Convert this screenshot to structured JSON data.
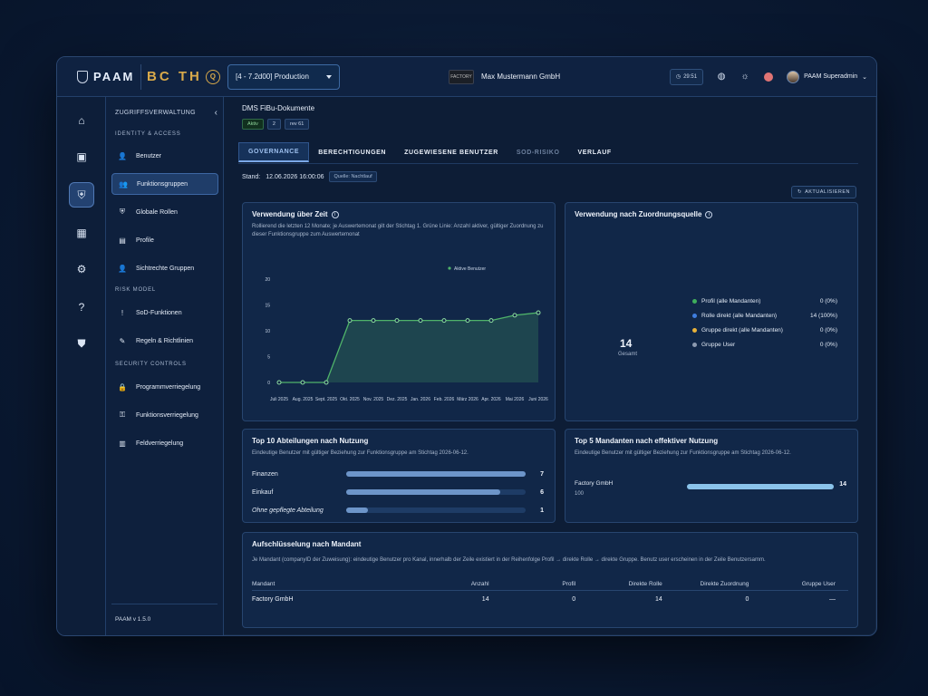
{
  "topbar": {
    "brand": "PAAM",
    "partner_logo": "BC TH",
    "partner_logo_q": "Q",
    "env_select": "[4 - 7.2d00] Production",
    "company_logo_text": "FACTORY",
    "company_name": "Max Mustermann GmbH",
    "timer": "29:51",
    "user_name": "PAAM Superadmin"
  },
  "rail": {
    "items": [
      {
        "icon": "home-icon",
        "glyph": "⌂"
      },
      {
        "icon": "monitor-icon",
        "glyph": "▣"
      },
      {
        "icon": "shield-user-icon",
        "glyph": "⛨"
      },
      {
        "icon": "building-icon",
        "glyph": "▦"
      },
      {
        "icon": "cogs-icon",
        "glyph": "⚙"
      },
      {
        "icon": "help-icon",
        "glyph": "?"
      },
      {
        "icon": "shield-check-icon",
        "glyph": "⛊"
      }
    ]
  },
  "sidebar": {
    "title": "ZUGRIFFSVERWALTUNG",
    "sections": {
      "identity": "IDENTITY & ACCESS",
      "risk": "RISK MODEL",
      "security": "SECURITY CONTROLS"
    },
    "items": [
      {
        "label": "Benutzer",
        "glyph": "👤"
      },
      {
        "label": "Funktionsgruppen",
        "glyph": "👥"
      },
      {
        "label": "Globale Rollen",
        "glyph": "⛨"
      },
      {
        "label": "Profile",
        "glyph": "▤"
      },
      {
        "label": "Sichtrechte Gruppen",
        "glyph": "👤"
      },
      {
        "label": "SoD-Funktionen",
        "glyph": "!"
      },
      {
        "label": "Regeln & Richtlinien",
        "glyph": "✎"
      },
      {
        "label": "Programmverriegelung",
        "glyph": "🔒"
      },
      {
        "label": "Funktionsverriegelung",
        "glyph": "⚿"
      },
      {
        "label": "Feldverriegelung",
        "glyph": "▥"
      }
    ],
    "version": "PAAM v 1.5.0"
  },
  "main": {
    "doc_title": "DMS FiBu-Dokumente",
    "badges": [
      "Aktiv",
      "2",
      "rev 61"
    ],
    "tabs": [
      "GOVERNANCE",
      "BERECHTIGUNGEN",
      "ZUGEWIESENE BENUTZER",
      "SOD-RISIKO",
      "VERLAUF"
    ],
    "stand_label": "Stand:",
    "stand_value": "12.06.2026 16:00:06",
    "source": "Quelle: Nachtlauf",
    "refresh": "AKTUALISIEREN"
  },
  "usage_card": {
    "title": "Verwendung über Zeit",
    "desc": "Rollierend die letzten 12 Monate; je Auswertemonat gilt der Stichtag 1. Grüne Linie: Anzahl aktiver, gültiger Zuordnung zu dieser Funktionsgruppe zum Auswertemonat"
  },
  "chart_data": {
    "type": "area",
    "x": [
      "Juli 2025",
      "Aug. 2025",
      "Sept. 2025",
      "Okt. 2025",
      "Nov. 2025",
      "Dez. 2025",
      "Jan. 2026",
      "Feb. 2026",
      "März 2026",
      "Apr. 2026",
      "Mai 2026",
      "Juni 2026"
    ],
    "series": [
      {
        "name": "Aktive Benutzer",
        "values": [
          0,
          0,
          0,
          12,
          12,
          12,
          12,
          12,
          12,
          12,
          13,
          13.5
        ]
      }
    ],
    "yticks": [
      0,
      5,
      10,
      15,
      20
    ],
    "ylim": [
      0,
      20
    ],
    "grid": false,
    "legend": "top-right",
    "color": "#4fb36a"
  },
  "source_card": {
    "title": "Verwendung nach Zuordnungsquelle",
    "total": "14",
    "total_label": "Gesamt",
    "legend": [
      {
        "name": "Profil (alle Mandanten)",
        "value": "0 (0%)",
        "color": "#3fae5c"
      },
      {
        "name": "Rolle direkt (alle Mandanten)",
        "value": "14 (100%)",
        "color": "#3f7ee0"
      },
      {
        "name": "Gruppe direkt (alle Mandanten)",
        "value": "0 (0%)",
        "color": "#e8b23a"
      },
      {
        "name": "Gruppe User",
        "value": "0 (0%)",
        "color": "#8c9ab0"
      }
    ]
  },
  "dept_card": {
    "title": "Top 10 Abteilungen nach Nutzung",
    "desc": "Eindeutige Benutzer mit gültiger Beziehung zur Funktionsgruppe am Stichtag 2026-06-12.",
    "rows": [
      {
        "label": "Finanzen",
        "value": "7",
        "fraction": 1.0
      },
      {
        "label": "Einkauf",
        "value": "6",
        "fraction": 0.86
      },
      {
        "label": "Ohne gepflegte Abteilung",
        "value": "1",
        "fraction": 0.12
      }
    ]
  },
  "mandant_card": {
    "title": "Top 5 Mandanten nach effektiver Nutzung",
    "desc": "Eindeutige Benutzer mit gültiger Beziehung zur Funktionsgruppe am Stichtag 2026-06-12.",
    "label": "Factory GmbH",
    "sub": "100",
    "value": "14",
    "fraction": 1.0
  },
  "breakdown_card": {
    "title": "Aufschlüsselung nach Mandant",
    "desc": "Je Mandant (companyID der Zuweisung): eindeutige Benutzer pro Kanal, innerhalb der Zeile existiert in der Reihenfolge Profil → direkte Rolle → direkte Gruppe. Benutz user erscheinen in der Zeile Benutzersamm.",
    "columns": [
      "Mandant",
      "Anzahl",
      "Profil",
      "Direkte Rolle",
      "Direkte Zuordnung",
      "Gruppe User"
    ],
    "rows": [
      [
        "Factory GmbH",
        "14",
        "0",
        "14",
        "0",
        "—"
      ]
    ]
  }
}
